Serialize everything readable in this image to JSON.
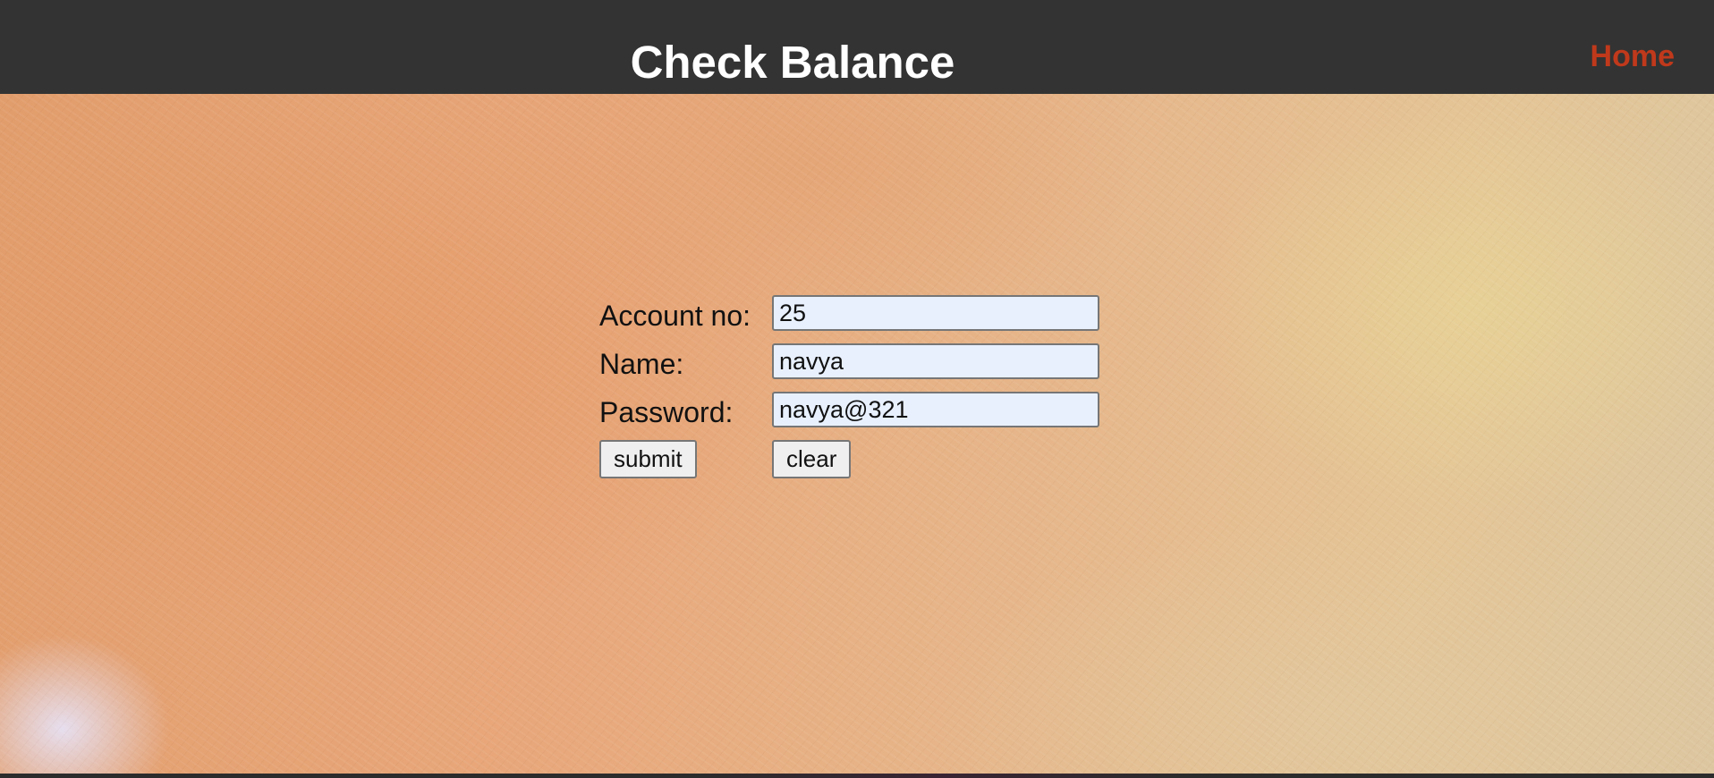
{
  "header": {
    "title": "Check Balance",
    "home_link": "Home",
    "home_color": "#c0391b",
    "background": "#333333"
  },
  "form": {
    "account": {
      "label": "Account no:",
      "value": "25"
    },
    "name": {
      "label": "Name:",
      "value": "navya"
    },
    "password": {
      "label": "Password:",
      "value": "navya@321"
    },
    "submit_label": "submit",
    "clear_label": "clear"
  }
}
